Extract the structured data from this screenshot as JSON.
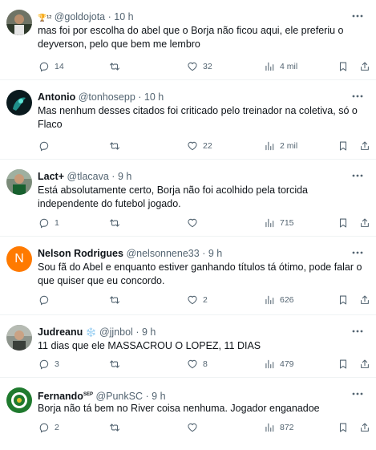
{
  "tweets": [
    {
      "name": "",
      "badge": "🏆¹²",
      "handle": "@goldojota",
      "time": "10 h",
      "text": "mas foi por escolha do abel que o Borja não ficou aqui, ele preferiu o deyverson, pelo que bem me lembro",
      "replies": "14",
      "retweets": "",
      "likes": "32",
      "views": "4 mil"
    },
    {
      "name": "Antonio",
      "badge": "",
      "handle": "@tonhosepp",
      "time": "10 h",
      "text": "Mas nenhum desses citados foi criticado pelo treinador na coletiva, só o Flaco",
      "replies": "",
      "retweets": "",
      "likes": "22",
      "views": "2 mil"
    },
    {
      "name": "Lact+",
      "badge": "",
      "handle": "@tlacava",
      "time": "9 h",
      "text": "Está absolutamente certo, Borja não foi acolhido pela torcida independente do futebol jogado.",
      "replies": "1",
      "retweets": "",
      "likes": "",
      "views": "715"
    },
    {
      "name": "Nelson Rodrigues",
      "badge": "",
      "handle": "@nelsonnene33",
      "time": "9 h",
      "text": "Sou fã do Abel e enquanto estiver ganhando títulos tá ótimo, pode falar o que quiser que eu concordo.",
      "replies": "",
      "retweets": "",
      "likes": "2",
      "views": "626",
      "avatar_letter": "N"
    },
    {
      "name": "Judreanu",
      "badge": "❄️",
      "handle": "@jjnbol",
      "time": "9 h",
      "text": "11 dias que ele MASSACROU O LOPEZ, 11 DIAS",
      "replies": "3",
      "retweets": "",
      "likes": "8",
      "views": "479"
    },
    {
      "name": "Fernando",
      "badge": "SEP",
      "handle": "@PunkSC",
      "time": "9 h",
      "text": "Borja não tá bem no River coisa nenhuma. Jogador enganadoe",
      "replies": "2",
      "retweets": "",
      "likes": "",
      "views": "872"
    }
  ],
  "sep": "·",
  "colors": {
    "text": "#0f1419",
    "muted": "#536471",
    "divider": "#eff3f4",
    "avatar_orange": "#ff7a00"
  }
}
